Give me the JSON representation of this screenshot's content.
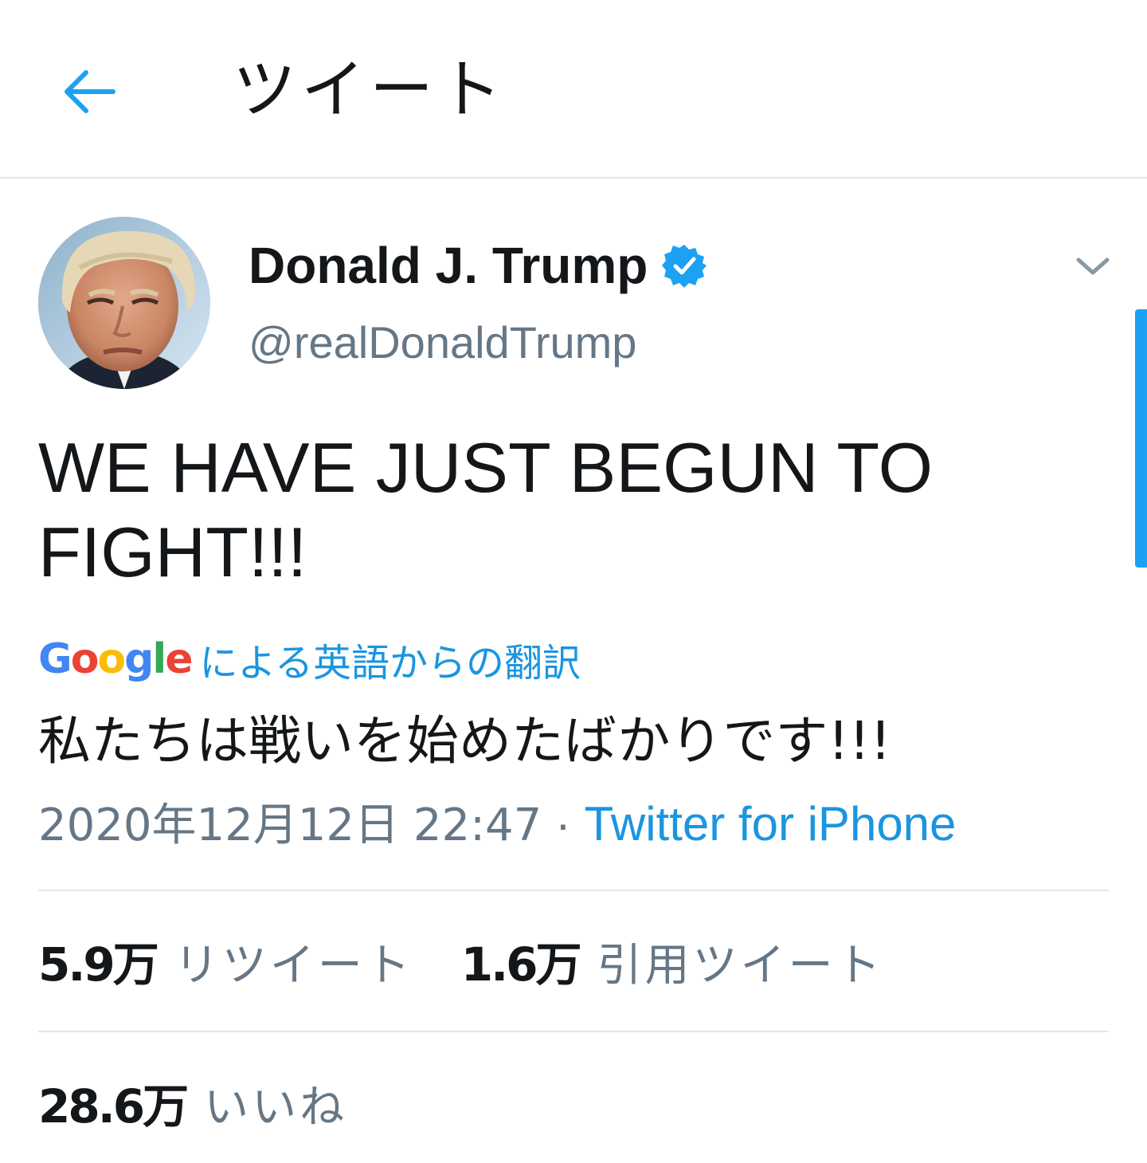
{
  "header": {
    "back_icon": "arrow-left-icon",
    "title": "ツイート"
  },
  "tweet": {
    "author": {
      "name": "Donald J. Trump",
      "handle": "@realDonaldTrump",
      "verified": true,
      "verified_icon": "verified-badge-icon",
      "avatar": "profile-photo"
    },
    "caret_icon": "chevron-down-icon",
    "text_lines": [
      "WE HAVE JUST BEGUN TO",
      "FIGHT!!!"
    ],
    "translation": {
      "provider_logo": "Google",
      "label": "による英語からの翻訳",
      "text": "私たちは戦いを始めたばかりです!!!"
    },
    "timestamp": "2020年12月12日 22:47",
    "separator": "·",
    "source": "Twitter for iPhone"
  },
  "stats": {
    "retweets": {
      "count": "5.9万",
      "label": "リツイート"
    },
    "quotes": {
      "count": "1.6万",
      "label": "引用ツイート"
    },
    "likes": {
      "count": "28.6万",
      "label": "いいね"
    }
  },
  "colors": {
    "accent": "#1da1f2",
    "link": "#1b95e0",
    "text": "#14171a",
    "secondary": "#657786",
    "divider": "#e1e8ed"
  }
}
